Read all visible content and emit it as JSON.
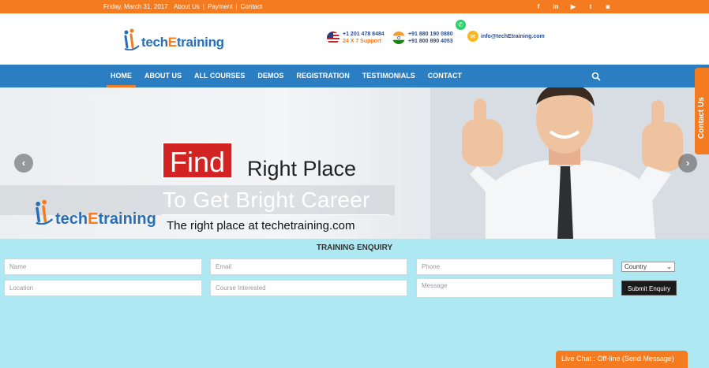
{
  "topbar": {
    "date": "Friday, March 31, 2017",
    "links": [
      "About Us",
      "Payment",
      "Contact"
    ],
    "social_icons": [
      "facebook-icon",
      "linkedin-icon",
      "youtube-icon",
      "twitter-icon",
      "rss-icon"
    ],
    "social_glyphs": [
      "f",
      "in",
      "▶",
      "t",
      "◙"
    ]
  },
  "brand": {
    "name_pre": "tech",
    "name_e": "E",
    "name_post": "training"
  },
  "contacts": {
    "us_phone": "+1 201 478 8484",
    "us_support": "24 X 7 Support",
    "in_phone1": "+91 880 190 0880",
    "in_phone2": "+91 800 890 4053",
    "email": "info@techEtraining.com"
  },
  "nav": {
    "items": [
      "HOME",
      "ABOUT US",
      "ALL COURSES",
      "DEMOS",
      "REGISTRATION",
      "TESTIMONIALS",
      "CONTACT"
    ]
  },
  "banner": {
    "find": "Find",
    "right_place": "Right Place",
    "bright": "To Get Bright Career",
    "tagline": "The right place at techetraining.com"
  },
  "side_tab": {
    "label": "Contact Us"
  },
  "form": {
    "title": "TRAINING ENQUIRY",
    "name_placeholder": "Name",
    "email_placeholder": "Email",
    "phone_placeholder": "Phone",
    "location_placeholder": "Location",
    "course_placeholder": "Course Interested",
    "message_placeholder": "Message",
    "country_selected": "Country",
    "submit_label": "Submit Enquiry"
  },
  "livechat": {
    "label": "Live Chat : Off-line (Send Message)"
  },
  "colors": {
    "accent": "#f47b20",
    "nav": "#2b7ec2",
    "form_bg": "#aee8f2"
  }
}
